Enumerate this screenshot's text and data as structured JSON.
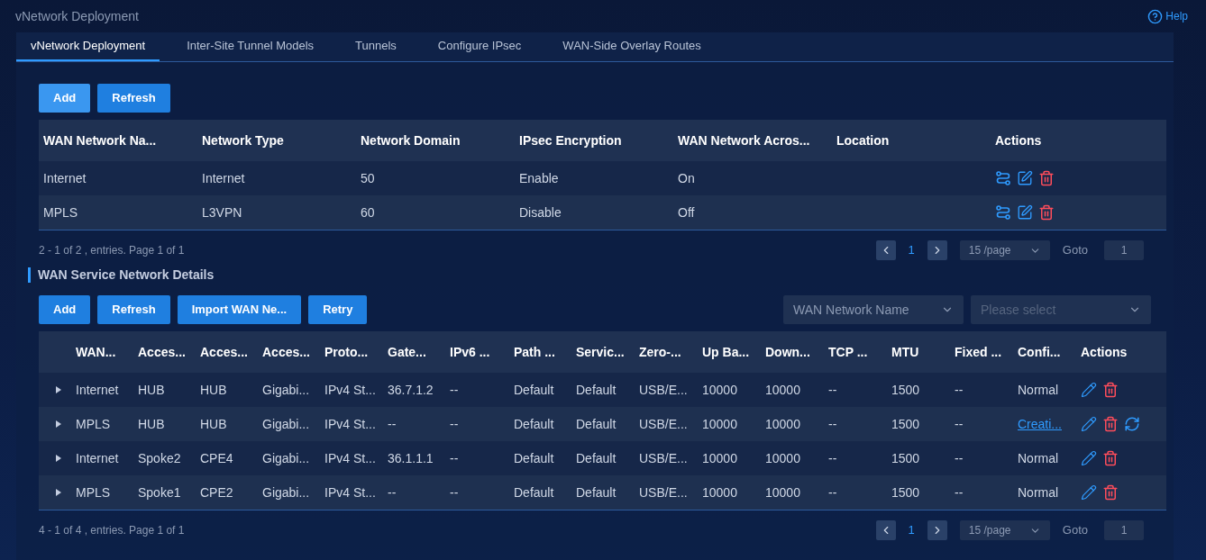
{
  "page_title": "vNetwork Deployment",
  "help": "Help",
  "tabs": [
    {
      "label": "vNetwork Deployment",
      "selected": true
    },
    {
      "label": "Inter-Site Tunnel Models",
      "selected": false
    },
    {
      "label": "Tunnels",
      "selected": false
    },
    {
      "label": "Configure IPsec",
      "selected": false
    },
    {
      "label": "WAN-Side Overlay Routes",
      "selected": false
    }
  ],
  "networks": {
    "buttons": [
      {
        "label": "Add",
        "kind": "primary"
      },
      {
        "label": "Refresh",
        "kind": "normal"
      }
    ],
    "columns": [
      "WAN Network Na...",
      "Network Type",
      "Network Domain",
      "IPsec Encryption",
      "WAN Network Acros...",
      "Location",
      "Actions"
    ],
    "rows": [
      {
        "cells": [
          "Internet",
          "Internet",
          "50",
          "Enable",
          "On",
          ""
        ],
        "actions": [
          {
            "kind": "links"
          },
          {
            "kind": "edit-list"
          },
          {
            "kind": "delete"
          }
        ]
      },
      {
        "cells": [
          "MPLS",
          "L3VPN",
          "60",
          "Disable",
          "Off",
          ""
        ],
        "actions": [
          {
            "kind": "links"
          },
          {
            "kind": "edit-list"
          },
          {
            "kind": "delete"
          }
        ]
      }
    ],
    "summary": "2 - 1 of 2 , entries. Page 1 of 1",
    "pager": {
      "page": "1",
      "page_size": "15 /page",
      "goto_label": "Goto",
      "goto_value": "1"
    }
  },
  "details": {
    "title": "WAN Service Network Details",
    "buttons": [
      {
        "label": "Add",
        "kind": "normal"
      },
      {
        "label": "Refresh",
        "kind": "normal"
      },
      {
        "label": "Import WAN Ne...",
        "kind": "normal"
      },
      {
        "label": "Retry",
        "kind": "normal"
      }
    ],
    "filter": {
      "label": "WAN Network Name",
      "placeholder": "Please select"
    },
    "columns": [
      "WAN...",
      "Acces...",
      "Acces...",
      "Acces...",
      "Proto...",
      "Gate...",
      "IPv6 ...",
      "Path ...",
      "Servic...",
      "Zero-...",
      "Up Ba...",
      "Down...",
      "TCP ...",
      "MTU",
      "Fixed ...",
      "Confi...",
      "Actions"
    ],
    "rows": [
      {
        "expanded": false,
        "cells": [
          "Internet",
          "HUB",
          "HUB",
          "Gigabi...",
          "IPv4 St...",
          "36.7.1.2",
          "--",
          "Default",
          "Default",
          "USB/E...",
          "10000",
          "10000",
          "--",
          "1500",
          "--"
        ],
        "config": {
          "text": "Normal",
          "link": false
        },
        "actions": [
          {
            "kind": "edit"
          },
          {
            "kind": "delete"
          }
        ]
      },
      {
        "expanded": false,
        "cells": [
          "MPLS",
          "HUB",
          "HUB",
          "Gigabi...",
          "IPv4 St...",
          "--",
          "--",
          "Default",
          "Default",
          "USB/E...",
          "10000",
          "10000",
          "--",
          "1500",
          "--"
        ],
        "config": {
          "text": "Creati...",
          "link": true
        },
        "actions": [
          {
            "kind": "edit"
          },
          {
            "kind": "delete"
          },
          {
            "kind": "retry"
          }
        ]
      },
      {
        "expanded": false,
        "cells": [
          "Internet",
          "Spoke2",
          "CPE4",
          "Gigabi...",
          "IPv4 St...",
          "36.1.1.1",
          "--",
          "Default",
          "Default",
          "USB/E...",
          "10000",
          "10000",
          "--",
          "1500",
          "--"
        ],
        "config": {
          "text": "Normal",
          "link": false
        },
        "actions": [
          {
            "kind": "edit"
          },
          {
            "kind": "delete"
          }
        ]
      },
      {
        "expanded": false,
        "cells": [
          "MPLS",
          "Spoke1",
          "CPE2",
          "Gigabi...",
          "IPv4 St...",
          "--",
          "--",
          "Default",
          "Default",
          "USB/E...",
          "10000",
          "10000",
          "--",
          "1500",
          "--"
        ],
        "config": {
          "text": "Normal",
          "link": false
        },
        "actions": [
          {
            "kind": "edit"
          },
          {
            "kind": "delete"
          }
        ]
      }
    ],
    "summary": "4 - 1 of 4 , entries. Page 1 of 1",
    "pager": {
      "page": "1",
      "page_size": "15 /page",
      "goto_label": "Goto",
      "goto_value": "1"
    }
  }
}
